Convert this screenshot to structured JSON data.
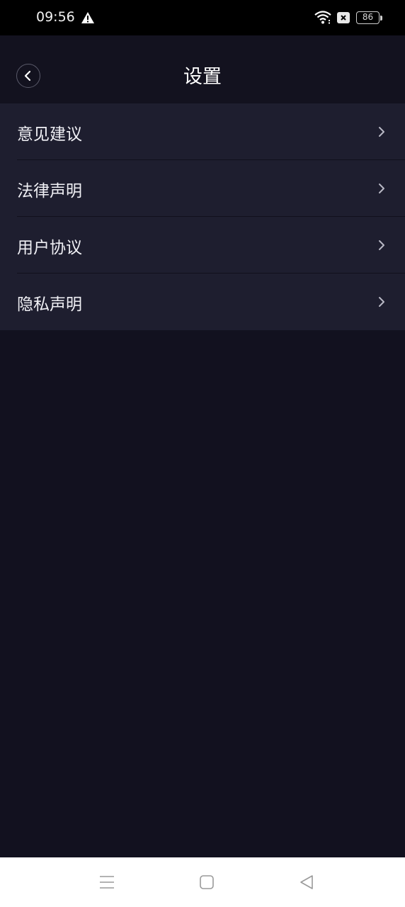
{
  "status_bar": {
    "time": "09:56",
    "battery": "86",
    "icons": [
      "warning-icon",
      "wifi-icon",
      "no-sim-icon",
      "battery-icon"
    ]
  },
  "header": {
    "title": "设置",
    "back_icon": "chevron-left-icon"
  },
  "settings": {
    "items": [
      {
        "label": "意见建议"
      },
      {
        "label": "法律声明"
      },
      {
        "label": "用户协议"
      },
      {
        "label": "隐私声明"
      }
    ]
  },
  "nav_bar": {
    "icons": [
      "menu-icon",
      "home-icon",
      "back-triangle-icon"
    ]
  },
  "colors": {
    "background": "#12111f",
    "list_background": "#1e1e2f",
    "text": "#f0f0f5",
    "chevron": "#b8b8c4"
  }
}
